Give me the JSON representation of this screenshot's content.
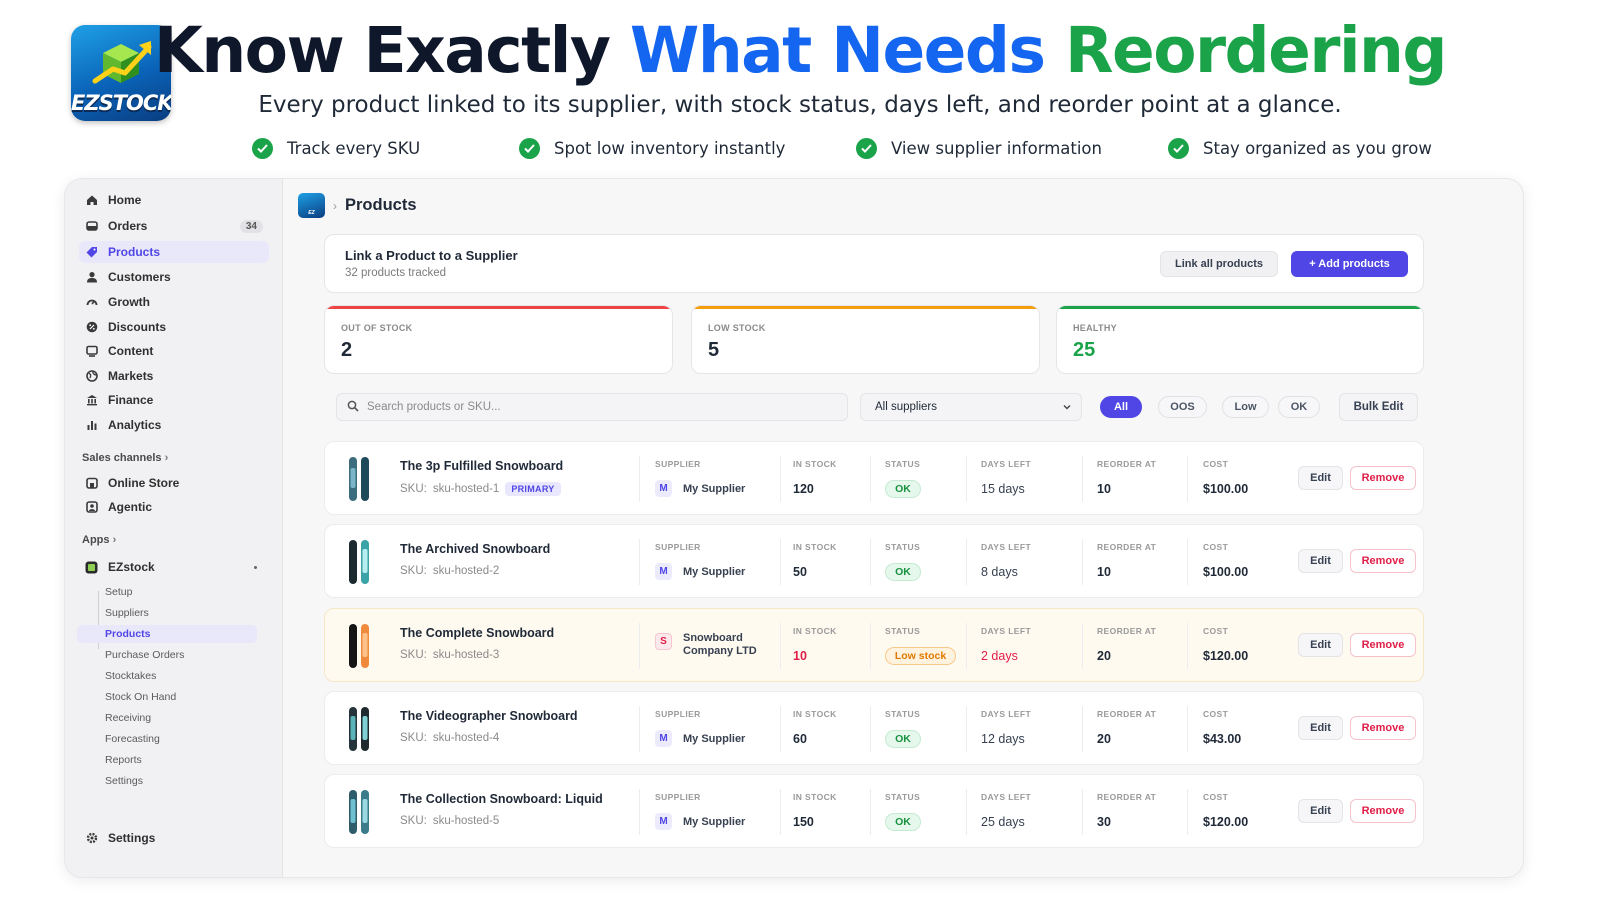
{
  "brand": {
    "logo_text": "EZSTOCK"
  },
  "hero": {
    "title_part1": "Know Exactly ",
    "title_part2": "What Needs ",
    "title_part3": "Reordering",
    "subtitle": "Every product linked to its supplier, with stock status, days left, and reorder point at a glance.",
    "features": [
      "Track every SKU",
      "Spot low inventory instantly",
      "View supplier information",
      "Stay organized as you grow"
    ],
    "colors": {
      "blue": "#1466f0",
      "green": "#1ba34a"
    }
  },
  "sidebar": {
    "nav": [
      {
        "label": "Home",
        "icon": "home-icon"
      },
      {
        "label": "Orders",
        "icon": "orders-icon",
        "badge": "34"
      },
      {
        "label": "Products",
        "icon": "tag-icon",
        "active": true
      },
      {
        "label": "Customers",
        "icon": "person-icon"
      },
      {
        "label": "Growth",
        "icon": "gauge-icon"
      },
      {
        "label": "Discounts",
        "icon": "discount-icon"
      },
      {
        "label": "Content",
        "icon": "content-icon"
      },
      {
        "label": "Markets",
        "icon": "globe-icon"
      },
      {
        "label": "Finance",
        "icon": "bank-icon"
      },
      {
        "label": "Analytics",
        "icon": "bar-chart-icon"
      }
    ],
    "sales_channels_label": "Sales channels",
    "channels": [
      {
        "label": "Online Store",
        "icon": "store-icon"
      },
      {
        "label": "Agentic",
        "icon": "agent-icon"
      }
    ],
    "apps_label": "Apps",
    "app_name": "EZstock",
    "app_items": [
      "Setup",
      "Suppliers",
      "Products",
      "Purchase Orders",
      "Stocktakes",
      "Stock On Hand",
      "Receiving",
      "Forecasting",
      "Reports",
      "Settings"
    ],
    "settings_label": "Settings"
  },
  "main": {
    "breadcrumb_title": "Products",
    "link_card": {
      "title": "Link a Product to a Supplier",
      "subtitle": "32 products tracked",
      "link_all_label": "Link all products",
      "add_label": "+ Add products"
    },
    "stats": [
      {
        "label": "OUT OF STOCK",
        "value": "2",
        "color": "#ef4444"
      },
      {
        "label": "LOW STOCK",
        "value": "5",
        "color": "#f59e0b"
      },
      {
        "label": "HEALTHY",
        "value": "25",
        "color": "#1ba34a"
      }
    ],
    "filters": {
      "search_placeholder": "Search products or SKU...",
      "supplier_select": "All suppliers",
      "pills": [
        "All",
        "OOS",
        "Low",
        "OK"
      ],
      "bulk_edit": "Bulk Edit"
    },
    "columns": {
      "supplier": "SUPPLIER",
      "in_stock": "IN STOCK",
      "status": "STATUS",
      "days_left": "DAYS LEFT",
      "reorder_at": "REORDER AT",
      "cost": "COST"
    },
    "actions": {
      "edit": "Edit",
      "remove": "Remove"
    },
    "products": [
      {
        "name": "The 3p Fulfilled Snowboard",
        "sku_label": "SKU:",
        "sku": "sku-hosted-1",
        "badge": "PRIMARY",
        "supplier_initial": "M",
        "supplier": "My Supplier",
        "in_stock": "120",
        "status": "OK",
        "days_left": "15 days",
        "reorder_at": "10",
        "cost": "$100.00"
      },
      {
        "name": "The Archived Snowboard",
        "sku_label": "SKU:",
        "sku": "sku-hosted-2",
        "supplier_initial": "M",
        "supplier": "My Supplier",
        "in_stock": "50",
        "status": "OK",
        "days_left": "8 days",
        "reorder_at": "10",
        "cost": "$100.00"
      },
      {
        "name": "The Complete Snowboard",
        "sku_label": "SKU:",
        "sku": "sku-hosted-3",
        "supplier_initial": "S",
        "supplier_line1": "Snowboard",
        "supplier_line2": "Company LTD",
        "in_stock": "10",
        "status": "Low stock",
        "days_left": "2 days",
        "reorder_at": "20",
        "cost": "$120.00"
      },
      {
        "name": "The Videographer Snowboard",
        "sku_label": "SKU:",
        "sku": "sku-hosted-4",
        "supplier_initial": "M",
        "supplier": "My Supplier",
        "in_stock": "60",
        "status": "OK",
        "days_left": "12 days",
        "reorder_at": "20",
        "cost": "$43.00"
      },
      {
        "name": "The Collection Snowboard: Liquid",
        "sku_label": "SKU:",
        "sku": "sku-hosted-5",
        "supplier_initial": "M",
        "supplier": "My Supplier",
        "in_stock": "150",
        "status": "OK",
        "days_left": "25 days",
        "reorder_at": "30",
        "cost": "$120.00"
      }
    ]
  }
}
